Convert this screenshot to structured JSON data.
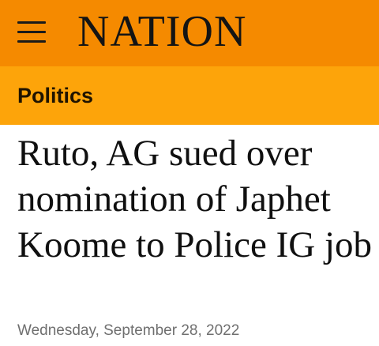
{
  "header": {
    "logo_text": "NATION",
    "menu_icon": "hamburger-menu-icon",
    "background": "#f58a00"
  },
  "section": {
    "label": "Politics",
    "background": "#fda40a"
  },
  "article": {
    "headline": "Ruto, AG sued over nomination of Japhet Koome to Police IG job",
    "date": "Wednesday, September 28, 2022"
  }
}
